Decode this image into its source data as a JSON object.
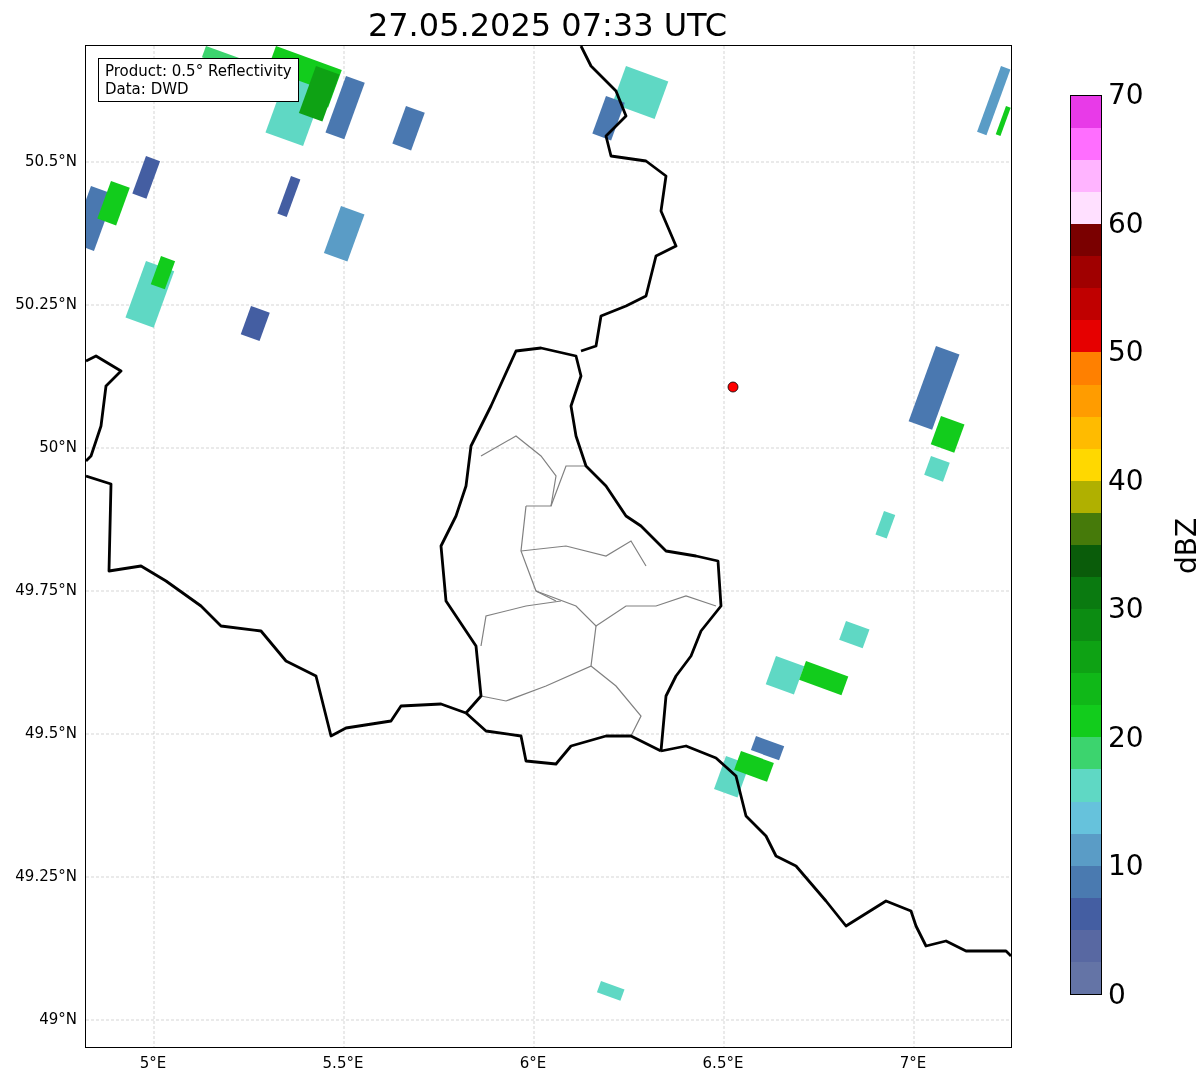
{
  "title": "27.05.2025 07:33 UTC",
  "map": {
    "info_box": [
      "Product: 0.5° Reflectivity",
      "Data: DWD"
    ],
    "y_ticks": [
      "50.5°N",
      "50.25°N",
      "50°N",
      "49.75°N",
      "49.5°N",
      "49.25°N",
      "49°N"
    ],
    "x_ticks": [
      "5°E",
      "5.5°E",
      "6°E",
      "6.5°E",
      "7°E"
    ]
  },
  "colorbar": {
    "label": "dBZ",
    "ticks": [
      "70",
      "60",
      "50",
      "40",
      "30",
      "20",
      "10",
      "0"
    ],
    "bands": [
      {
        "color": "#6474a6"
      },
      {
        "color": "#5868a2"
      },
      {
        "color": "#445ea2"
      },
      {
        "color": "#4a7ab0"
      },
      {
        "color": "#5a9cc6"
      },
      {
        "color": "#66c2dc"
      },
      {
        "color": "#5fd8c4"
      },
      {
        "color": "#3cd46e"
      },
      {
        "color": "#12cc1c"
      },
      {
        "color": "#10b818"
      },
      {
        "color": "#0ea214"
      },
      {
        "color": "#0c8c12"
      },
      {
        "color": "#0a7a10"
      },
      {
        "color": "#0a5c0a"
      },
      {
        "color": "#467a0a"
      },
      {
        "color": "#b0b000"
      },
      {
        "color": "#ffd800"
      },
      {
        "color": "#ffbb00"
      },
      {
        "color": "#ff9c00"
      },
      {
        "color": "#ff8000"
      },
      {
        "color": "#e60000"
      },
      {
        "color": "#c00000"
      },
      {
        "color": "#a00000"
      },
      {
        "color": "#7a0000"
      },
      {
        "color": "#ffe0ff"
      },
      {
        "color": "#ffb4ff"
      },
      {
        "color": "#ff6eff"
      },
      {
        "color": "#e83ae8"
      }
    ]
  }
}
